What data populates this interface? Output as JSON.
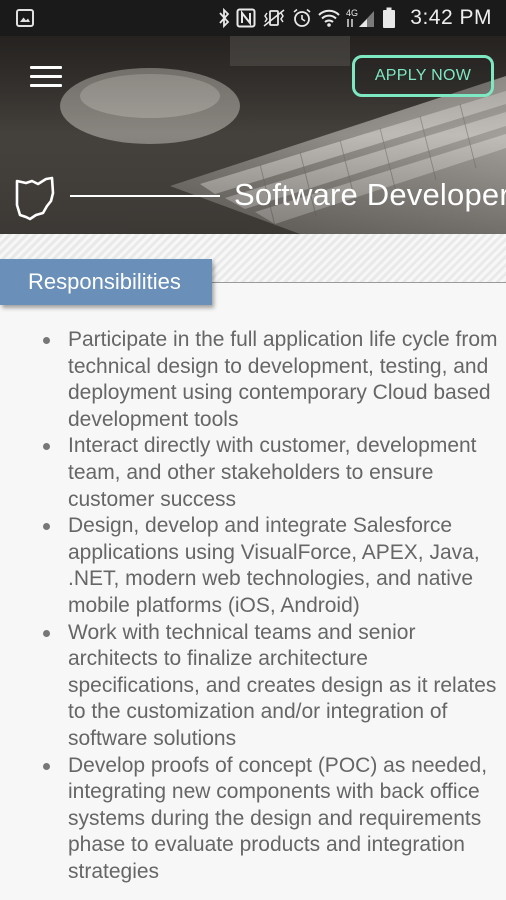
{
  "status_bar": {
    "time": "3:42 PM",
    "network_label": "4G"
  },
  "header": {
    "apply_label": "APPLY NOW",
    "title": "Software Developer"
  },
  "section": {
    "tab_label": "Responsibilities"
  },
  "responsibilities": [
    "Participate in the full application life cycle from technical design to development, testing, and deployment using contemporary Cloud based development tools",
    "Interact directly with customer, development team, and other stakeholders to ensure customer success",
    "Design, develop and integrate Salesforce applications using VisualForce, APEX, Java, .NET, modern web technologies, and native mobile platforms (iOS, Android)",
    "Work with technical teams and senior architects to finalize architecture specifications, and creates design as it relates to the customization and/or integration of software solutions",
    "Develop proofs of concept (POC) as needed, integrating new components with back office systems during the design and requirements phase to evaluate products and integration strategies"
  ],
  "colors": {
    "accent_green": "#7ee8c3",
    "tab_blue": "#6a8fb8",
    "body_text": "#666666"
  },
  "icons": {
    "status_left": "image-icon",
    "bluetooth": "bluetooth-icon",
    "nfc": "nfc-icon",
    "vibrate": "vibrate-icon",
    "alarm": "alarm-icon",
    "wifi": "wifi-icon",
    "signal": "signal-icon",
    "battery": "battery-icon",
    "menu": "hamburger-menu-icon",
    "state": "ohio-outline-icon"
  }
}
